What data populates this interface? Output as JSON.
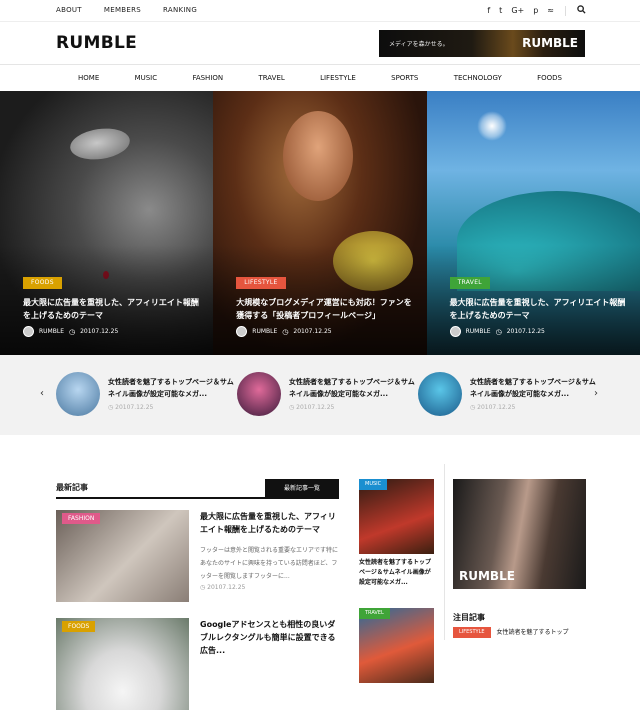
{
  "topbar": {
    "links": [
      "ABOUT",
      "MEMBERS",
      "RANKING"
    ],
    "social": [
      {
        "icon": "facebook-icon",
        "glyph": "f"
      },
      {
        "icon": "twitter-icon",
        "glyph": "t"
      },
      {
        "icon": "google-plus-icon",
        "glyph": "G+"
      },
      {
        "icon": "pinterest-icon",
        "glyph": "p"
      },
      {
        "icon": "rss-icon",
        "glyph": "≈"
      }
    ],
    "search_icon": "search-icon"
  },
  "header": {
    "logo": "RUMBLE",
    "banner_tagline": "メディアを森かせる。",
    "banner_logo": "RUMBLE"
  },
  "nav": [
    "HOME",
    "MUSIC",
    "FASHION",
    "TRAVEL",
    "LIFESTYLE",
    "SPORTS",
    "TECHNOLOGY",
    "FOODS"
  ],
  "hero": [
    {
      "category": "FOODS",
      "title": "最大限に広告量を重視した、アフィリエイト報酬を上げるためのテーマ",
      "author": "RUMBLE",
      "date": "20107.12.25",
      "color": "#d9a100"
    },
    {
      "category": "LIFESTYLE",
      "title": "大規模なブログメディア運営にも対応！ファンを獲得する「投稿者プロフィールページ」",
      "author": "RUMBLE",
      "date": "20107.12.25",
      "color": "#e6553e"
    },
    {
      "category": "TRAVEL",
      "title": "最大限に広告量を重視した、アフィリエイト報酬を上げるためのテーマ",
      "author": "RUMBLE",
      "date": "20107.12.25",
      "color": "#3fa438"
    }
  ],
  "slider": {
    "items": [
      {
        "title": "女性読者を魅了するトップページ＆サムネイル画像が設定可能なメガ...",
        "date": "20107.12.25"
      },
      {
        "title": "女性読者を魅了するトップページ＆サムネイル画像が設定可能なメガ...",
        "date": "20107.12.25"
      },
      {
        "title": "女性読者を魅了するトップページ＆サムネイル画像が設定可能なメガ...",
        "date": "20107.12.25"
      }
    ]
  },
  "latest": {
    "heading": "最新記事",
    "all_button": "最新記事一覧",
    "posts": [
      {
        "category": "FASHION",
        "title": "最大限に広告量を重視した、アフィリエイト報酬を上げるためのテーマ",
        "excerpt": "フッターは意外と閲覧される重要なエリアです特にあなたのサイトに興味を持っている訪問者ほど、フッターを閲覧しますフッターに...",
        "date": "20107.12.25"
      },
      {
        "category": "FOODS",
        "title": "Googleアドセンスとも相性の良いダブルレクタングルも簡単に設置できる広告..."
      }
    ]
  },
  "middle": [
    {
      "category": "MUSIC",
      "title": "女性読者を魅了するトップページ＆サムネイル画像が設定可能なメガ..."
    },
    {
      "category": "TRAVEL"
    }
  ],
  "sidebar": {
    "ad_logo": "RUMBLE",
    "heading": "注目記事",
    "item": {
      "category": "LIFESTYLE",
      "title": "女性読者を魅了するトップ"
    }
  }
}
